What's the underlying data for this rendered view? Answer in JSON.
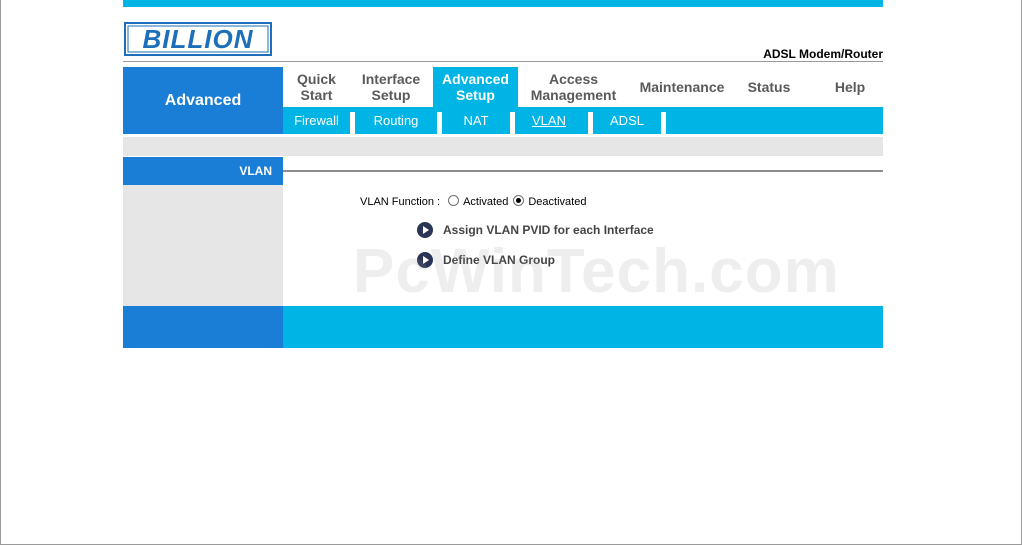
{
  "header": {
    "logo_text": "BILLION",
    "product_name": "ADSL Modem/Router"
  },
  "section": {
    "label": "Advanced"
  },
  "main_nav": [
    {
      "line1": "Quick",
      "line2": "Start",
      "active": false
    },
    {
      "line1": "Interface",
      "line2": "Setup",
      "active": false
    },
    {
      "line1": "Advanced",
      "line2": "Setup",
      "active": true
    },
    {
      "line1": "Access",
      "line2": "Management",
      "active": false
    },
    {
      "line1": "Maintenance",
      "line2": "",
      "active": false
    },
    {
      "line1": "Status",
      "line2": "",
      "active": false
    },
    {
      "line1": "Help",
      "line2": "",
      "active": false
    }
  ],
  "sub_nav": [
    "Firewall",
    "Routing",
    "NAT",
    "VLAN",
    "ADSL"
  ],
  "sub_nav_selected": "VLAN",
  "page": {
    "title": "VLAN",
    "function_label": "VLAN Function :",
    "options": [
      "Activated",
      "Deactivated"
    ],
    "selected_option": "Deactivated",
    "links": [
      "Assign VLAN PVID for each Interface",
      "Define VLAN Group"
    ]
  },
  "watermark": "PcWinTech.com",
  "colors": {
    "accent_cyan": "#00b5e6",
    "accent_blue": "#1a7ed6",
    "logo_blue": "#1c6fb8",
    "panel_gray": "#e6e6e6"
  }
}
